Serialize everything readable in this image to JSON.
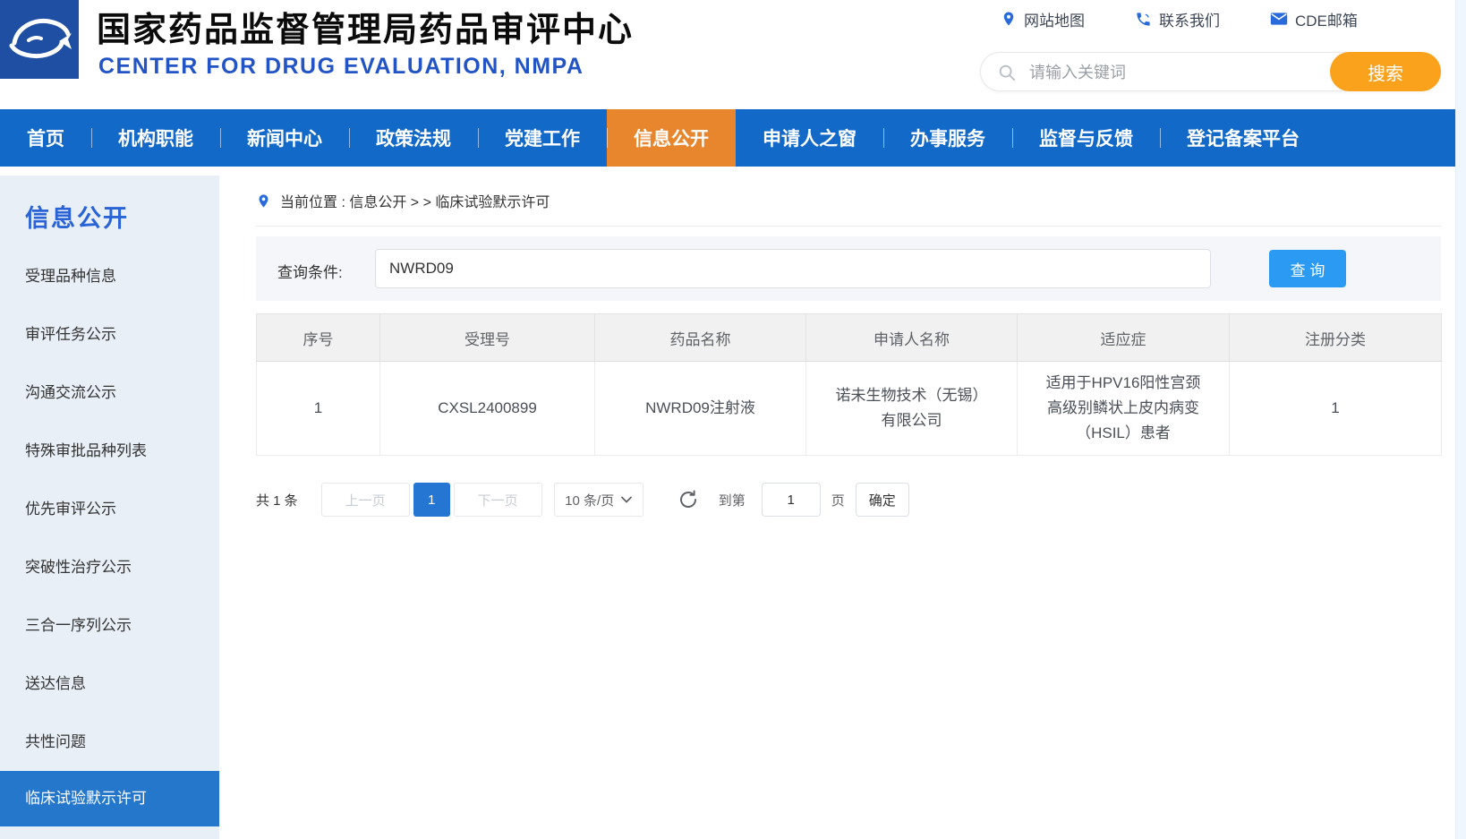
{
  "colors": {
    "nav_blue": "#1269C8",
    "nav_active_orange": "#E8862D",
    "search_button_orange": "#FBA21C",
    "query_button_blue": "#2B9AF3",
    "sidebar_active_blue": "#2577CB",
    "pagination_active_blue": "#2476D2",
    "sidebar_bg": "#E9EFF7",
    "logo_blue": "#1F4FA3",
    "icon_blue": "#2A6BDB"
  },
  "header": {
    "title_cn": "国家药品监督管理局药品审评中心",
    "title_en": "CENTER FOR DRUG EVALUATION, NMPA",
    "quick_links": [
      {
        "label": "网站地图",
        "icon": "map-pin-icon"
      },
      {
        "label": "联系我们",
        "icon": "phone-icon"
      },
      {
        "label": "CDE邮箱",
        "icon": "mail-icon"
      }
    ],
    "search": {
      "placeholder": "请输入关键词",
      "button_label": "搜索"
    }
  },
  "nav": {
    "active": "信息公开",
    "items": [
      "首页",
      "机构职能",
      "新闻中心",
      "政策法规",
      "党建工作",
      "信息公开",
      "申请人之窗",
      "办事服务",
      "监督与反馈",
      "登记备案平台"
    ]
  },
  "sidebar": {
    "title": "信息公开",
    "active": "临床试验默示许可",
    "items": [
      "受理品种信息",
      "审评任务公示",
      "沟通交流公示",
      "特殊审批品种列表",
      "优先审评公示",
      "突破性治疗公示",
      "三合一序列公示",
      "送达信息",
      "共性问题",
      "临床试验默示许可"
    ]
  },
  "breadcrumb": {
    "text": "当前位置 : 信息公开 > > 临床试验默示许可"
  },
  "query": {
    "label": "查询条件:",
    "value": "NWRD09",
    "button_label": "查 询"
  },
  "table": {
    "columns": [
      "序号",
      "受理号",
      "药品名称",
      "申请人名称",
      "适应症",
      "注册分类"
    ],
    "rows": [
      [
        "1",
        "CXSL2400899",
        "NWRD09注射液",
        "诺未生物技术（无锡）有限公司",
        "适用于HPV16阳性宫颈高级别鳞状上皮内病变（HSIL）患者",
        "1"
      ]
    ]
  },
  "pagination": {
    "total_label": "共 1 条",
    "prev_label": "上一页",
    "current_page": "1",
    "next_label": "下一页",
    "page_size_label": "10 条/页",
    "goto_prefix": "到第",
    "goto_value": "1",
    "goto_unit": "页",
    "confirm_label": "确定"
  }
}
